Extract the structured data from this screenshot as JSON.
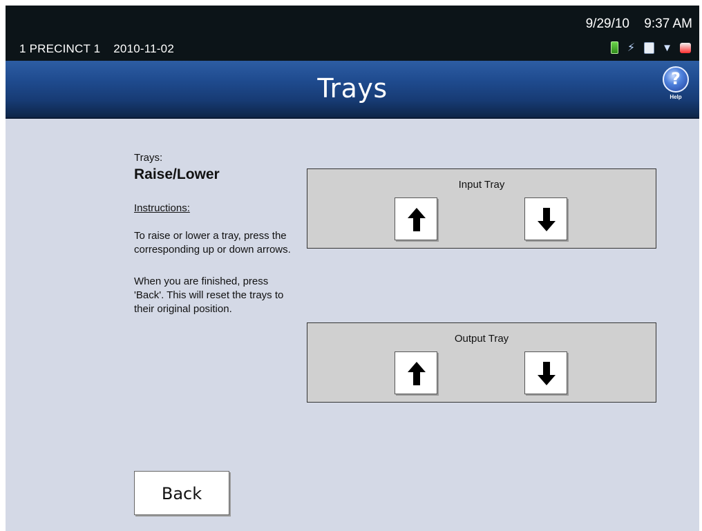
{
  "status_bar": {
    "precinct": "1 PRECINCT 1",
    "election_date": "2010-11-02",
    "date": "9/29/10",
    "time": "9:37 AM",
    "icons": [
      "battery-icon",
      "power-plug-icon",
      "document-icon",
      "network-icon",
      "printer-icon"
    ]
  },
  "header": {
    "title": "Trays",
    "help_label": "Help",
    "help_glyph": "?"
  },
  "instructions": {
    "section_label": "Trays:",
    "heading": "Raise/Lower",
    "title": "Instructions:",
    "paragraph1": "To raise or lower a tray, press the corresponding up or down arrows.",
    "paragraph2": "When you are finished, press 'Back'. This will reset the trays to their original position."
  },
  "trays": {
    "input": {
      "label": "Input Tray"
    },
    "output": {
      "label": "Output Tray"
    }
  },
  "footer": {
    "back_label": "Back"
  },
  "colors": {
    "title_bar": "#1f4b8f",
    "content_background": "#d4d9e6",
    "tray_panel": "#d0d0d0"
  }
}
